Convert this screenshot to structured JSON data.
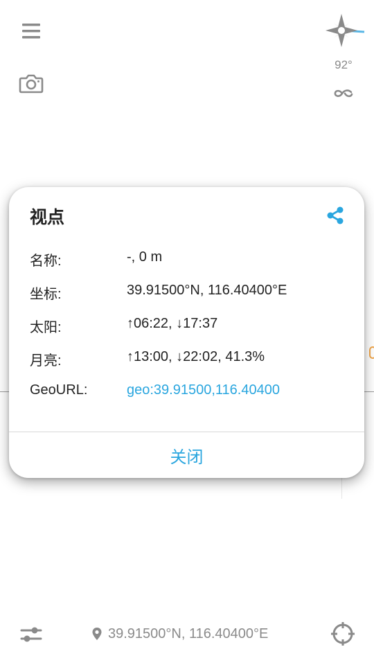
{
  "colors": {
    "accent": "#2aa6df",
    "icon_gray": "#8a8a8a",
    "compass_blue": "#5ab7e6"
  },
  "toolbar": {
    "menu_icon": "menu-icon",
    "camera_icon": "camera-icon",
    "compass_icon": "compass-icon",
    "heading": "92°",
    "link_icon": "link-icon"
  },
  "dialog": {
    "title": "视点",
    "share_icon": "share-icon",
    "rows": [
      {
        "label": "名称:",
        "value": "-, 0 m"
      },
      {
        "label": "坐标:",
        "value": "39.91500°N, 116.40400°E"
      },
      {
        "label": "太阳:",
        "value": "↑06:22, ↓17:37"
      },
      {
        "label": "月亮:",
        "value": "↑13:00, ↓22:02, 41.3%"
      },
      {
        "label": "GeoURL:",
        "value": "geo:39.91500,116.40400"
      }
    ],
    "close_label": "关闭"
  },
  "bottom_bar": {
    "settings_icon": "sliders-icon",
    "pin_icon": "location-pin-icon",
    "coordinates": "39.91500°N, 116.40400°E",
    "locate_icon": "crosshair-icon"
  }
}
